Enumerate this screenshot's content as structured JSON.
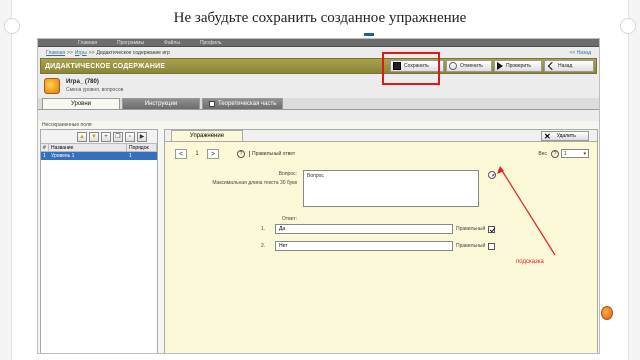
{
  "slide": {
    "title": "Не забудьте сохранить созданное упражнение"
  },
  "nav": {
    "items": [
      "Главная",
      "Программы",
      "Файлы",
      "Профиль"
    ]
  },
  "breadcrumb": {
    "items": [
      "Главная",
      "Игры",
      "Дидактическое содержание игр"
    ],
    "back": "<< Назад"
  },
  "header": {
    "title": "ДИДАКТИЧЕСКОЕ СОДЕРЖАНИЕ",
    "save_label": "Сохранить",
    "cancel_label": "Отменить",
    "check_label": "Проверить",
    "back_label": "Назад"
  },
  "game": {
    "title": "Игра_ (780)",
    "subtitle": "Смена уровня, вопросов"
  },
  "tabs": {
    "levels": "Уровни",
    "instructions": "Инструкции",
    "theory": "Теоретическая часть"
  },
  "content": {
    "hint": "Несохраненные поля"
  },
  "levels_table": {
    "headers": [
      "#",
      "Название",
      "Порядок"
    ],
    "rows": [
      {
        "num": "1",
        "name": "Уровень 1",
        "order": "1"
      }
    ]
  },
  "exercise": {
    "tab_label": "Упражнение",
    "delete_label": "Удалить",
    "nav_index": "1",
    "type_label": "Правильный ответ",
    "points_label": "Вес",
    "points_value": "1",
    "question_label": "Вопрос:",
    "question_text": "Вопрос",
    "max_chars_label": "Максимальная длина текста 30 букв",
    "answer_label": "Ответ:",
    "answers": [
      {
        "num": "1.",
        "text": "Да",
        "correct_label": "Правильный",
        "correct": true
      },
      {
        "num": "2.",
        "text": "Нет",
        "correct_label": "Правильный",
        "correct": false
      }
    ]
  },
  "annotation": {
    "label": "подсказка",
    "color": "#e02020"
  }
}
